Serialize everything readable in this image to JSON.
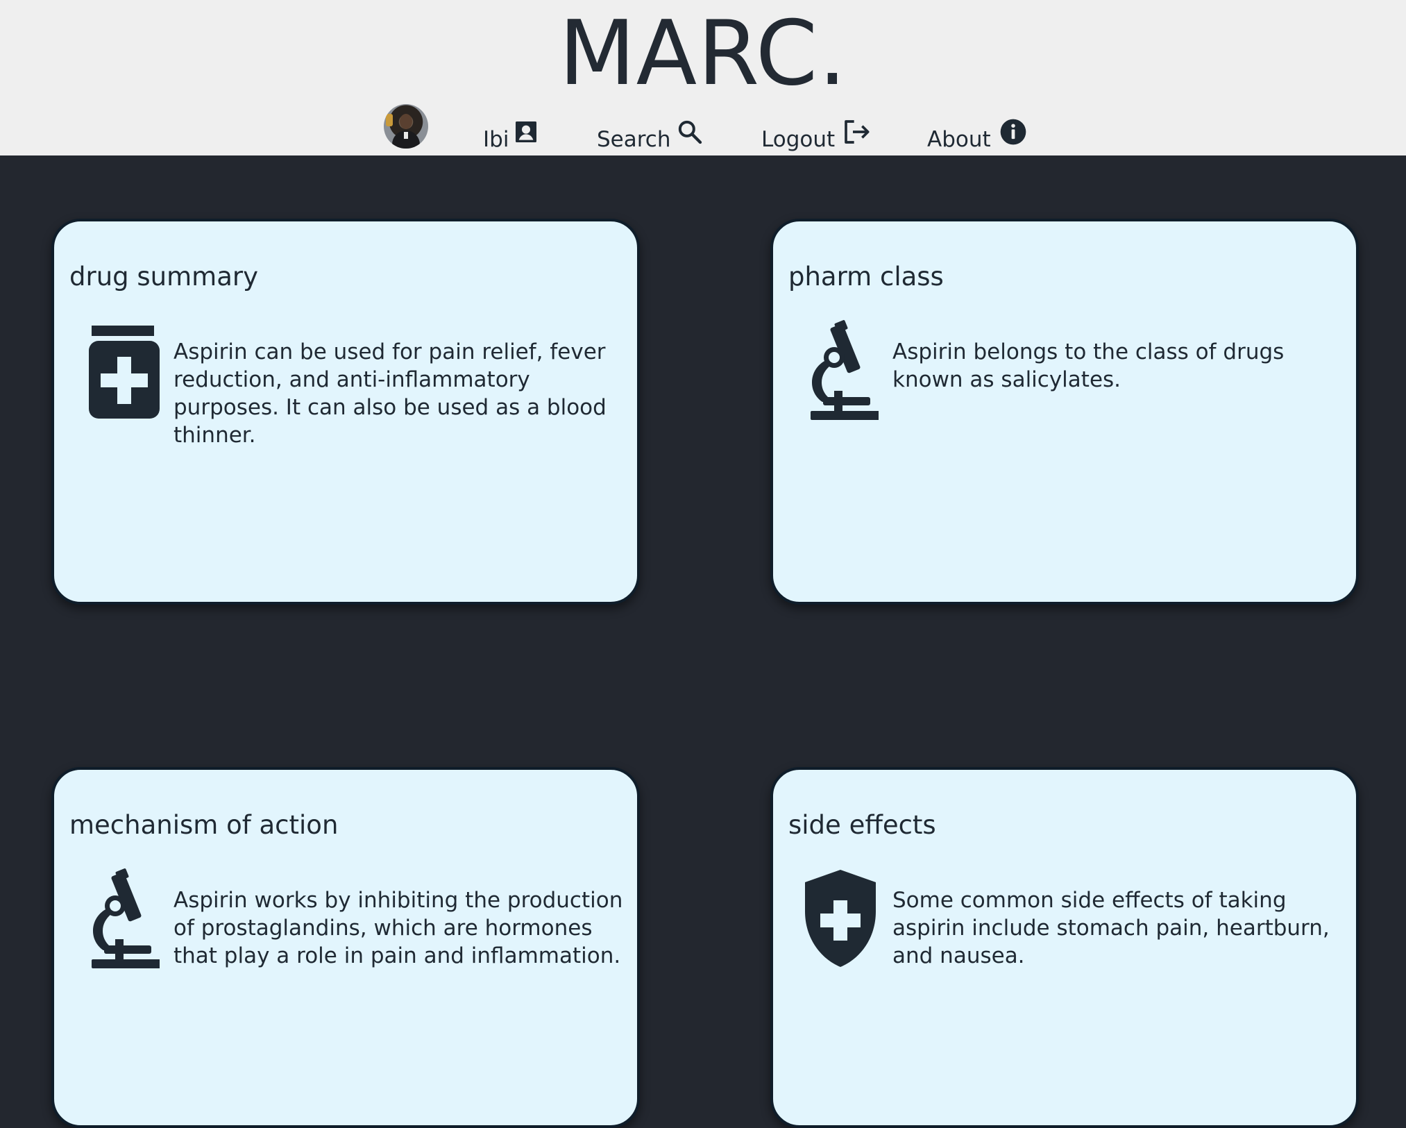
{
  "brand": "MARC.",
  "nav": {
    "user_label": "Ibi",
    "search_label": "Search",
    "logout_label": "Logout",
    "about_label": "About"
  },
  "cards": [
    {
      "title": "drug summary",
      "icon": "medicine-bottle-icon",
      "text": "Aspirin can be used for pain relief, fever reduction, and anti-inflammatory purposes. It can also be used as a blood thinner."
    },
    {
      "title": "pharm class",
      "icon": "microscope-icon",
      "text": "Aspirin belongs to the class of drugs known as salicylates."
    },
    {
      "title": "mechanism of action",
      "icon": "microscope-icon",
      "text": "Aspirin works by inhibiting the production of prostaglandins, which are hormones that play a role in pain and inflammation."
    },
    {
      "title": "side effects",
      "icon": "shield-plus-icon",
      "text": "Some common side effects of taking aspirin include stomach pain, heartburn, and nausea."
    }
  ],
  "colors": {
    "header_bg": "#efefef",
    "page_bg": "#23272f",
    "card_bg": "#e2f5fd",
    "text": "#1f2933"
  }
}
